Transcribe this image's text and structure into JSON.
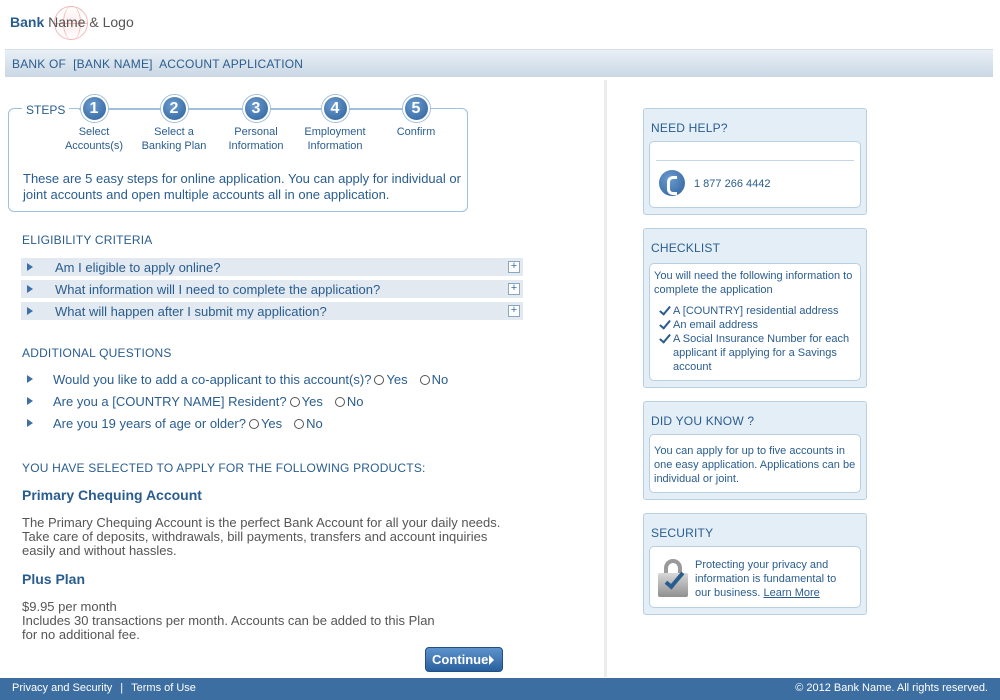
{
  "header": {
    "logo_bold": "Bank",
    "logo_rest": " Name & Logo",
    "title": "BANK OF  [BANK NAME]  ACCOUNT APPLICATION"
  },
  "steps": {
    "label": "STEPS",
    "items": [
      {
        "num": "1",
        "label": "Select Accounts(s)"
      },
      {
        "num": "2",
        "label": "Select a Banking Plan"
      },
      {
        "num": "3",
        "label": "Personal Information"
      },
      {
        "num": "4",
        "label": "Employment Information"
      },
      {
        "num": "5",
        "label": "Confirm"
      }
    ],
    "description": "These are 5 easy steps for online application. You can apply for individual or joint accounts and open multiple accounts all in one application."
  },
  "eligibility": {
    "title": "ELIGIBILITY CRITERIA",
    "items": [
      "Am I eligible to apply online?",
      "What information will I need to complete the application?",
      "What will happen after I submit my application?"
    ]
  },
  "questions": {
    "title": "ADDITIONAL QUESTIONS",
    "items": [
      {
        "text": "Would you like to add a co-applicant to this account(s)?",
        "yes": "Yes",
        "no": "No"
      },
      {
        "text": "Are you a [COUNTRY NAME] Resident?",
        "yes": "Yes",
        "no": "No"
      },
      {
        "text": "Are you 19 years of age or older?",
        "yes": "Yes",
        "no": "No"
      }
    ]
  },
  "products": {
    "title": "YOU HAVE SELECTED TO APPLY FOR THE FOLLOWING PRODUCTS:",
    "account_name": "Primary Chequing Account",
    "account_desc": "The Primary Chequing Account is the perfect Bank Account for all your daily needs. Take care of deposits, withdrawals, bill payments, transfers and account inquiries easily and without hassles.",
    "plan_name": "Plus Plan",
    "plan_price": "$9.95 per month",
    "plan_desc1": "Includes 30 transactions per month. Accounts can be added to this Plan",
    "plan_desc2": "for no additional fee."
  },
  "continue_label": "Continue",
  "help": {
    "title": "NEED HELP?",
    "phone": "1 877 266 4442"
  },
  "checklist": {
    "title": "CHECKLIST",
    "intro": "You will need the following information to complete the application",
    "items": [
      "A [COUNTRY] residential address",
      "An email address",
      "A Social Insurance Number for each applicant if applying for a Savings account"
    ]
  },
  "didyouknow": {
    "title": "DID YOU KNOW ?",
    "text": "You can apply for up to five accounts in one easy application. Applications can be individual or joint."
  },
  "security": {
    "title": "SECURITY",
    "text": "Protecting your privacy and information is fundamental to our business.",
    "link": "Learn More"
  },
  "footer": {
    "privacy": "Privacy and Security",
    "separator": "|",
    "terms": "Terms of Use",
    "copyright": "© 2012 Bank Name. All rights reserved."
  },
  "colors": {
    "accent": "#2a5d8f",
    "footer_bg": "#3c6ea2",
    "panel_bg": "#e4eef7"
  }
}
